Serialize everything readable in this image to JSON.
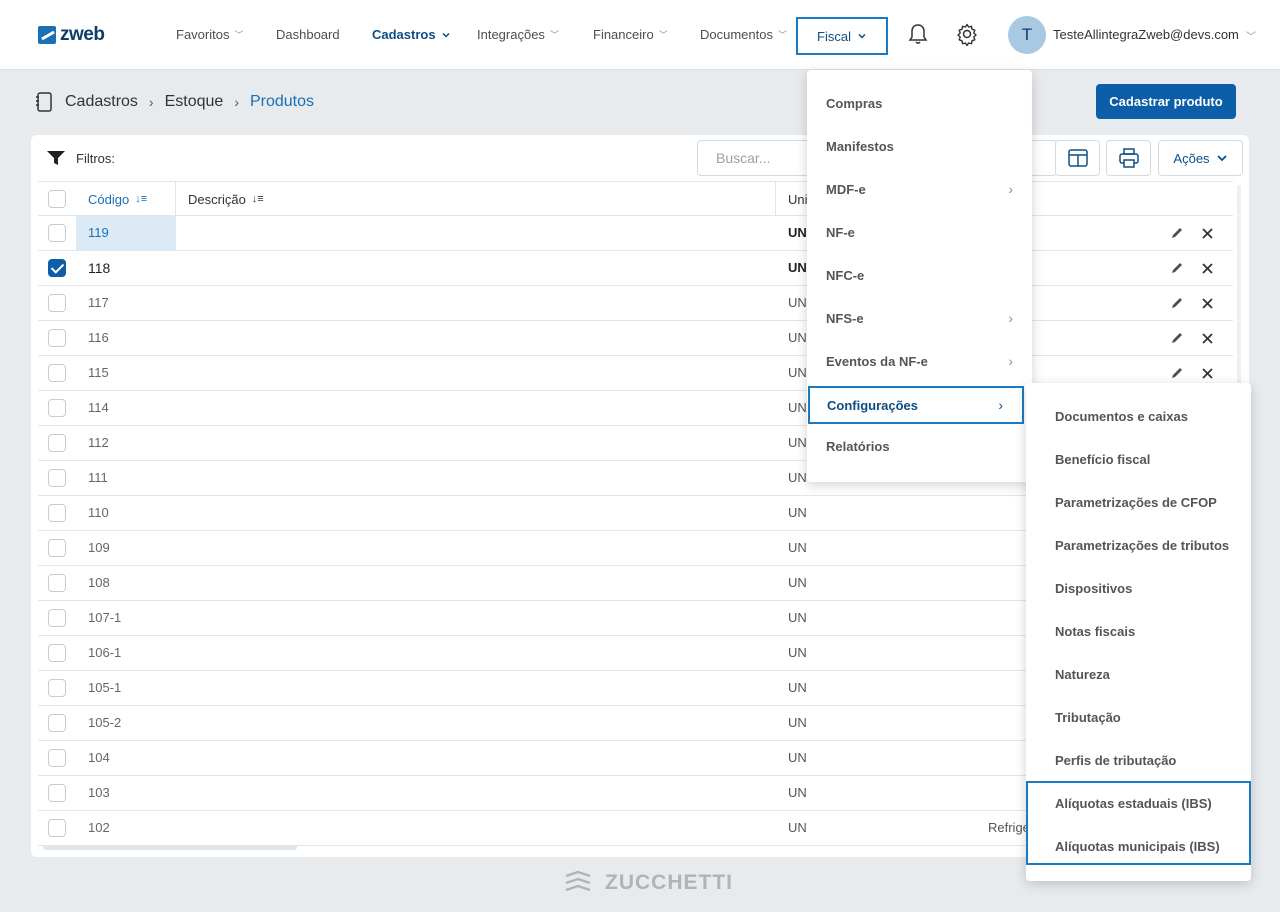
{
  "brand": {
    "name": "zweb"
  },
  "nav": {
    "items": [
      {
        "label": "Favoritos"
      },
      {
        "label": "Dashboard"
      },
      {
        "label": "Cadastros"
      },
      {
        "label": "Integrações"
      },
      {
        "label": "Financeiro"
      },
      {
        "label": "Documentos"
      },
      {
        "label": "Fiscal"
      }
    ],
    "active": "Cadastros",
    "open": "Fiscal"
  },
  "user": {
    "initial": "T",
    "email": "TesteAllintegraZweb@devs.com"
  },
  "breadcrumb": {
    "items": [
      "Cadastros",
      "Estoque",
      "Produtos"
    ]
  },
  "page": {
    "primary_button": "Cadastrar produto"
  },
  "toolbar": {
    "filters_label": "Filtros:",
    "search_placeholder": "Buscar...",
    "actions_label": "Ações"
  },
  "table": {
    "columns": {
      "code": "Código",
      "description": "Descrição",
      "unit": "Uni"
    },
    "rows": [
      {
        "code": "119",
        "unit": "UN",
        "checked": false
      },
      {
        "code": "118",
        "unit": "UN",
        "checked": true
      },
      {
        "code": "117",
        "unit": "UN",
        "checked": false
      },
      {
        "code": "116",
        "unit": "UN",
        "checked": false
      },
      {
        "code": "115",
        "unit": "UN",
        "checked": false
      },
      {
        "code": "114",
        "unit": "UN",
        "checked": false
      },
      {
        "code": "112",
        "unit": "UN",
        "checked": false
      },
      {
        "code": "111",
        "unit": "UN",
        "checked": false
      },
      {
        "code": "110",
        "unit": "UN",
        "checked": false
      },
      {
        "code": "109",
        "unit": "UN",
        "checked": false
      },
      {
        "code": "108",
        "unit": "UN",
        "checked": false
      },
      {
        "code": "107-1",
        "unit": "UN",
        "checked": false
      },
      {
        "code": "106-1",
        "unit": "UN",
        "checked": false
      },
      {
        "code": "105-1",
        "unit": "UN",
        "checked": false
      },
      {
        "code": "105-2",
        "unit": "UN",
        "checked": false
      },
      {
        "code": "104",
        "unit": "UN",
        "checked": false
      },
      {
        "code": "103",
        "unit": "UN",
        "checked": false
      },
      {
        "code": "102",
        "unit": "UN",
        "checked": false,
        "extra": "Refrige"
      }
    ]
  },
  "fiscal_menu": {
    "items": [
      {
        "label": "Compras",
        "has_sub": false
      },
      {
        "label": "Manifestos",
        "has_sub": false
      },
      {
        "label": "MDF-e",
        "has_sub": true
      },
      {
        "label": "NF-e",
        "has_sub": false
      },
      {
        "label": "NFC-e",
        "has_sub": false
      },
      {
        "label": "NFS-e",
        "has_sub": true
      },
      {
        "label": "Eventos da NF-e",
        "has_sub": true
      },
      {
        "label": "Configurações",
        "has_sub": true
      },
      {
        "label": "Relatórios",
        "has_sub": false
      }
    ],
    "active": "Configurações"
  },
  "config_submenu": {
    "items": [
      "Documentos e caixas",
      "Benefício fiscal",
      "Parametrizações de CFOP",
      "Parametrizações de tributos",
      "Dispositivos",
      "Notas fiscais",
      "Natureza",
      "Tributação",
      "Perfis de tributação",
      "Alíquotas estaduais (IBS)",
      "Alíquotas municipais (IBS)"
    ]
  },
  "footer": {
    "brand": "ZUCCHETTI"
  },
  "colors": {
    "accent": "#0d5ea8",
    "highlight_border": "#1a7bc4",
    "background": "#e8ebee"
  }
}
